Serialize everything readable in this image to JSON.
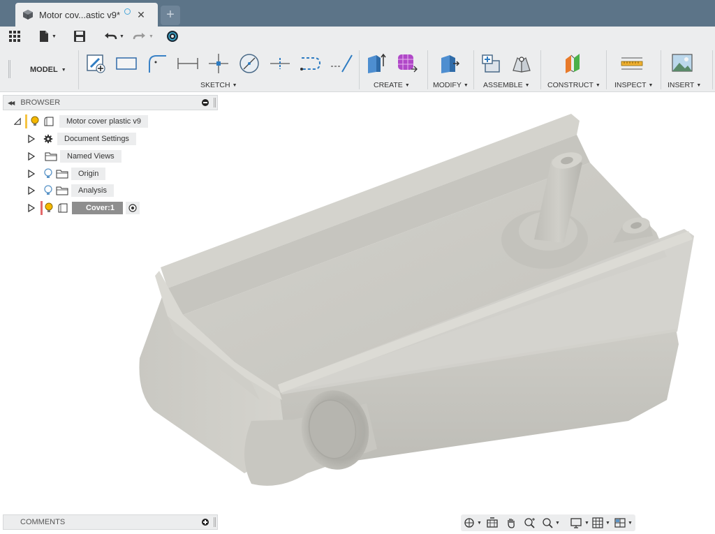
{
  "document": {
    "tab_title": "Motor cov...astic v9*",
    "close_glyph": "✕",
    "new_tab_glyph": "+"
  },
  "ribbon": {
    "workspace": "MODEL",
    "panels": {
      "sketch": "SKETCH",
      "create": "CREATE",
      "modify": "MODIFY",
      "assemble": "ASSEMBLE",
      "construct": "CONSTRUCT",
      "inspect": "INSPECT",
      "insert": "INSERT"
    }
  },
  "browser": {
    "title": "BROWSER",
    "root": "Motor cover plastic v9",
    "items": [
      {
        "label": "Document Settings",
        "icon": "gear-icon"
      },
      {
        "label": "Named Views",
        "icon": "folder-icon"
      },
      {
        "label": "Origin",
        "icon": "folder-icon"
      },
      {
        "label": "Analysis",
        "icon": "folder-icon"
      },
      {
        "label": "Cover:1",
        "icon": "body-icon"
      }
    ]
  },
  "comments": {
    "title": "COMMENTS"
  },
  "colors": {
    "titlebar": "#5c7488",
    "toolbar": "#ecedee",
    "model": "#c8c7c1",
    "bulb": "#f5b800",
    "bulb_off": "#5b95c8",
    "flag_root": "#f6c443",
    "flag_cover": "#e46a6a"
  }
}
